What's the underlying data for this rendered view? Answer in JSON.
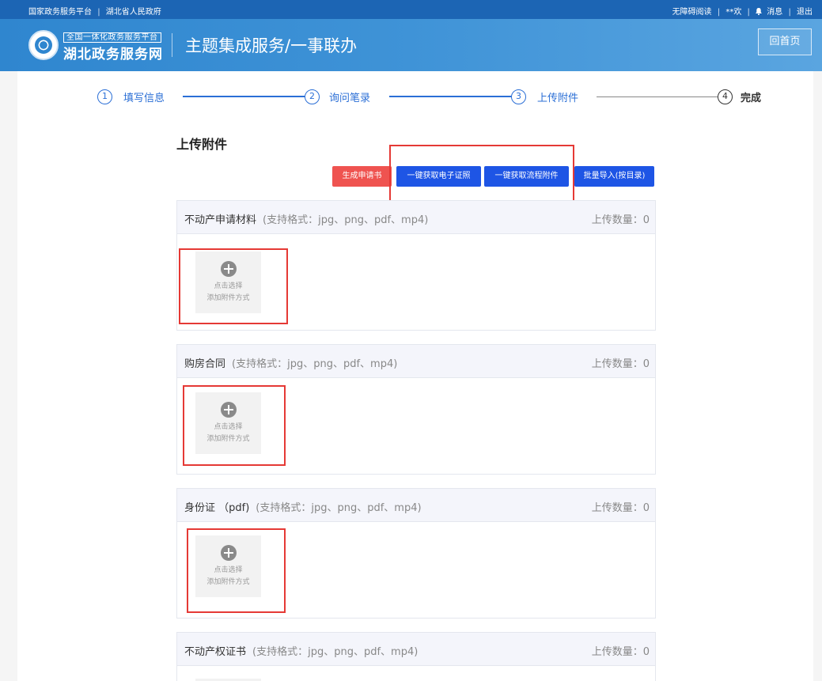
{
  "topbar": {
    "left_links": [
      "国家政务服务平台",
      "湖北省人民政府"
    ],
    "accessibility": "无障碍阅读",
    "user": "**欢",
    "messages": "消息",
    "logout": "退出"
  },
  "header": {
    "logo_sub": "全国一体化政务服务平台",
    "logo_main": "湖北政务服务网",
    "title": "主题集成服务/一事联办",
    "home_button": "回首页"
  },
  "steps": [
    {
      "num": "1",
      "label": "填写信息"
    },
    {
      "num": "2",
      "label": "询问笔录"
    },
    {
      "num": "3",
      "label": "上传附件"
    },
    {
      "num": "4",
      "label": "完成"
    }
  ],
  "section_title": "上传附件",
  "actions": {
    "generate": "生成申请书",
    "get_cert": "一键获取电子证照",
    "get_flow": "一键获取流程附件",
    "batch": "批量导入(按目录)"
  },
  "panels": [
    {
      "name": "不动产申请材料",
      "formats": "(支持格式：jpg、png、pdf、mp4)",
      "count": "上传数量：0"
    },
    {
      "name": "购房合同",
      "formats": "(支持格式：jpg、png、pdf、mp4)",
      "count": "上传数量：0"
    },
    {
      "name": "身份证 （pdf)",
      "formats": "(支持格式：jpg、png、pdf、mp4)",
      "count": "上传数量：0"
    },
    {
      "name": "不动产权证书",
      "formats": "(支持格式：jpg、png、pdf、mp4)",
      "count": "上传数量：0"
    }
  ],
  "upload_tile": {
    "line1": "点击选择",
    "line2": "添加附件方式"
  },
  "colors": {
    "primary": "#1e55e5",
    "header": "#2f86cf",
    "danger": "#ef5350",
    "highlight": "#e53935"
  },
  "icons": {
    "plus": "plus-circle-icon",
    "bell": "bell-icon",
    "logo": "emblem-icon"
  }
}
